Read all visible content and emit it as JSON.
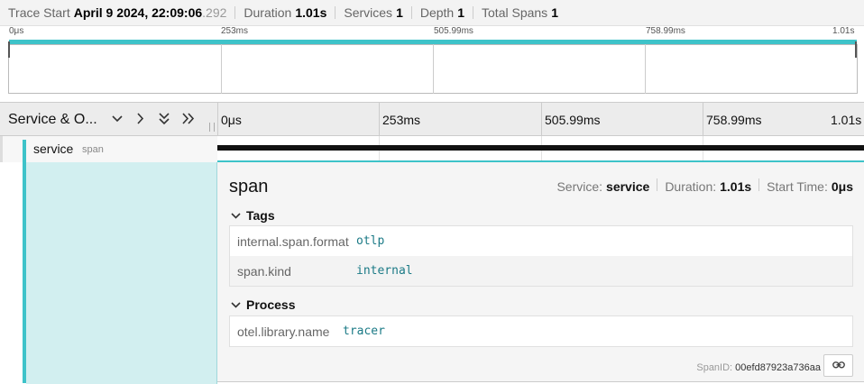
{
  "stats": {
    "trace_start_label": "Trace Start",
    "trace_start_value": "April 9 2024, 22:09:06",
    "trace_start_ms": ".292",
    "duration_label": "Duration",
    "duration_value": "1.01s",
    "services_label": "Services",
    "services_value": "1",
    "depth_label": "Depth",
    "depth_value": "1",
    "total_spans_label": "Total Spans",
    "total_spans_value": "1"
  },
  "minimap": {
    "ticks": [
      "0μs",
      "253ms",
      "505.99ms",
      "758.99ms",
      "1.01s"
    ]
  },
  "timeline": {
    "column_title": "Service & O...",
    "ticks": [
      "0μs",
      "253ms",
      "505.99ms",
      "758.99ms",
      "1.01s"
    ],
    "controls": {
      "collapse_one": "chevron-down-icon",
      "expand_one": "chevron-right-icon",
      "collapse_all": "double-chevron-down-icon",
      "expand_all": "double-chevron-right-icon"
    }
  },
  "span_row": {
    "service": "service",
    "operation": "span"
  },
  "detail": {
    "title": "span",
    "service_label": "Service:",
    "service_value": "service",
    "duration_label": "Duration:",
    "duration_value": "1.01s",
    "start_label": "Start Time:",
    "start_value": "0μs",
    "tags_title": "Tags",
    "tags": [
      {
        "key": "internal.span.format",
        "value": "otlp"
      },
      {
        "key": "span.kind",
        "value": "internal"
      }
    ],
    "process_title": "Process",
    "process": [
      {
        "key": "otel.library.name",
        "value": "tracer"
      }
    ],
    "span_id_label": "SpanID:",
    "span_id_value": "00efd87923a736aa"
  },
  "colors": {
    "accent": "#3ec3c9",
    "selected_fill": "#d2eff0",
    "tag_value": "#1b7a86"
  }
}
